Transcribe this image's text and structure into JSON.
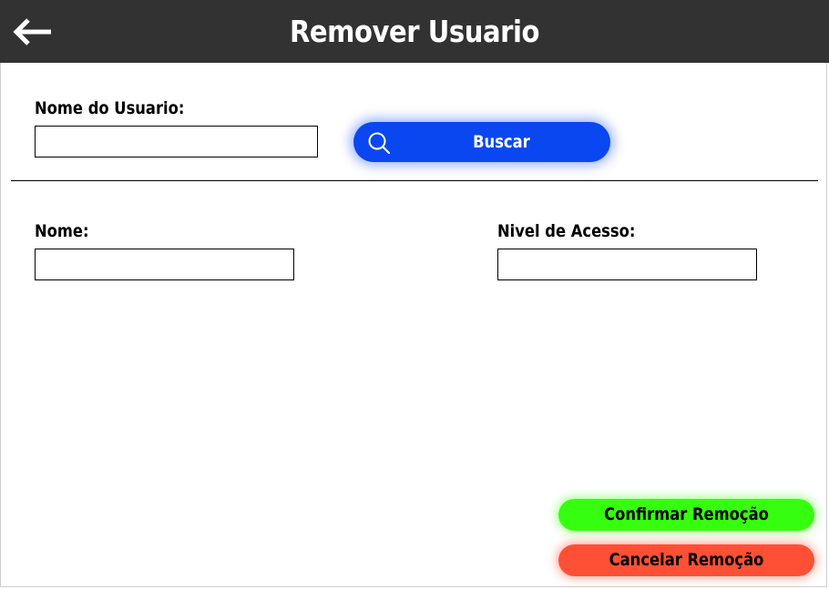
{
  "header": {
    "title": "Remover Usuario",
    "back_icon": "arrow-left-icon",
    "background_color": "#323232"
  },
  "search": {
    "label": "Nome do Usuario:",
    "value": "",
    "button_label": "Buscar",
    "button_icon": "search-icon",
    "button_color": "#0a47f0"
  },
  "details": {
    "name_label": "Nome:",
    "name_value": "",
    "access_label": "Nivel de Acesso:",
    "access_value": ""
  },
  "actions": {
    "confirm_label": "Confirmar Remoção",
    "confirm_color": "#35ff0e",
    "cancel_label": "Cancelar Remoção",
    "cancel_color": "#ff5035"
  }
}
